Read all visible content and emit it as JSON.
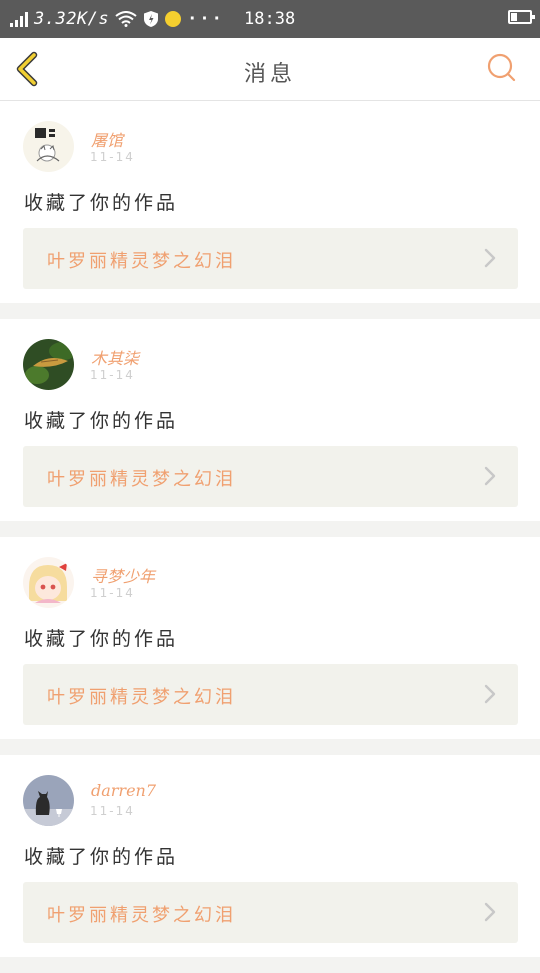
{
  "status_bar": {
    "speed": "3.32K/s",
    "time": "18:38",
    "icons": [
      "signal-icon",
      "wifi-icon",
      "shield-icon",
      "notification-dot-icon",
      "more-icon",
      "battery-icon"
    ]
  },
  "header": {
    "title": "消息",
    "back_icon": "chevron-left-icon",
    "search_icon": "search-icon"
  },
  "colors": {
    "accent": "#f0a070",
    "back_arrow": "#f1cf33",
    "background": "#f3f3f1",
    "card_inner": "#f2f2ec"
  },
  "notifications": [
    {
      "username": "屠馆",
      "time": "11-14",
      "action": "收藏了你的作品",
      "work_title": "叶罗丽精灵梦之幻泪"
    },
    {
      "username": "木其柒",
      "time": "11-14",
      "action": "收藏了你的作品",
      "work_title": "叶罗丽精灵梦之幻泪"
    },
    {
      "username": "寻梦少年",
      "time": "11-14",
      "action": "收藏了你的作品",
      "work_title": "叶罗丽精灵梦之幻泪"
    },
    {
      "username": "darren7",
      "time": "11-14",
      "action": "收藏了你的作品",
      "work_title": "叶罗丽精灵梦之幻泪"
    }
  ]
}
